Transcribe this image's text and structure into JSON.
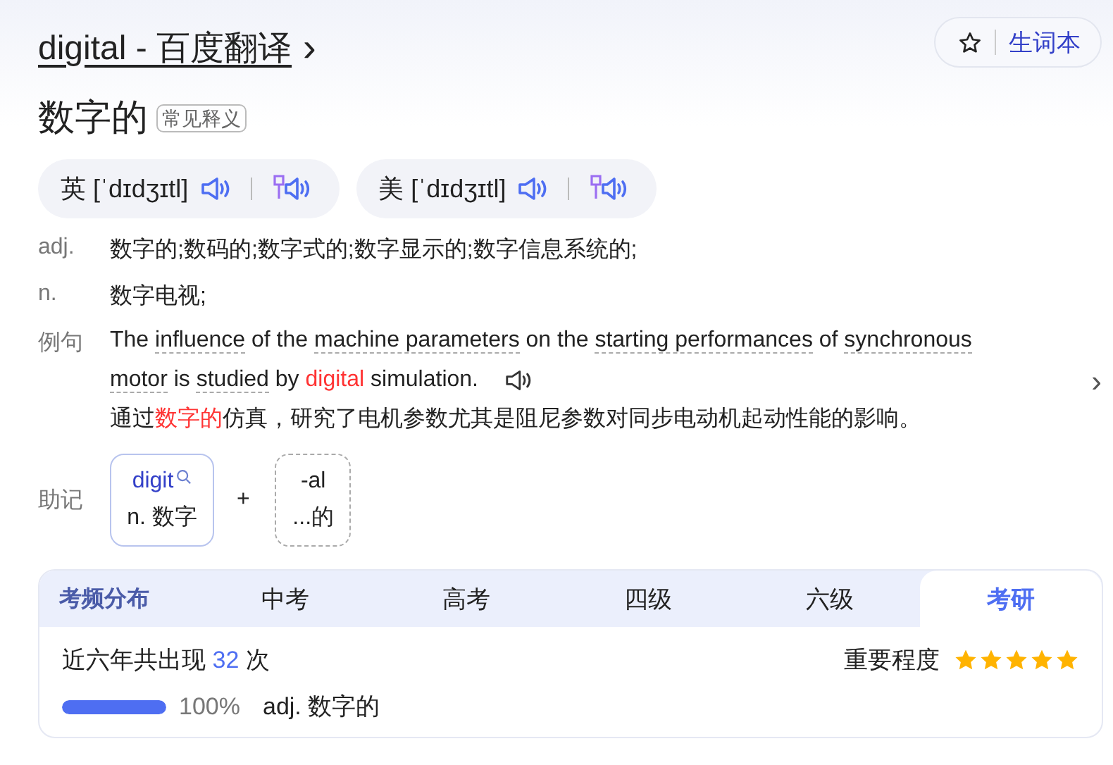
{
  "header": {
    "title": "digital - 百度翻译",
    "chevron": "›",
    "wordbook": "生词本"
  },
  "headword": {
    "text": "数字的",
    "tag": "常见释义"
  },
  "pronunciations": [
    {
      "region": "英",
      "phonetic": "[ˈdɪdʒɪtl]"
    },
    {
      "region": "美",
      "phonetic": "[ˈdɪdʒɪtl]"
    }
  ],
  "definitions": [
    {
      "pos": "adj.",
      "meaning": "数字的;数码的;数字式的;数字显示的;数字信息系统的;"
    },
    {
      "pos": "n.",
      "meaning": "数字电视;"
    }
  ],
  "example": {
    "label": "例句",
    "sentence": [
      {
        "kind": "plain",
        "text": "The "
      },
      {
        "kind": "term",
        "text": "influence"
      },
      {
        "kind": "plain",
        "text": " of the "
      },
      {
        "kind": "term",
        "text": "machine parameters"
      },
      {
        "kind": "plain",
        "text": " on the "
      },
      {
        "kind": "term",
        "text": "starting performances"
      },
      {
        "kind": "plain",
        "text": " of "
      },
      {
        "kind": "term",
        "text": "synchronous motor"
      },
      {
        "kind": "plain",
        "text": " is "
      },
      {
        "kind": "term",
        "text": "studied"
      },
      {
        "kind": "plain",
        "text": " by "
      },
      {
        "kind": "highlight",
        "text": "digital"
      },
      {
        "kind": "plain",
        "text": " simulation."
      }
    ],
    "translation": [
      {
        "kind": "plain",
        "text": "通过"
      },
      {
        "kind": "highlight",
        "text": "数字的"
      },
      {
        "kind": "plain",
        "text": "仿真，研究了电机参数尤其是阻尼参数对同步电动机起动性能的影响。"
      }
    ],
    "next": "›"
  },
  "mnemonic": {
    "label": "助记",
    "parts": [
      {
        "kind": "root",
        "word": "digit",
        "meaning": "n. 数字"
      },
      {
        "kind": "suffix",
        "word": "-al",
        "meaning": "...的"
      }
    ],
    "plus": "+"
  },
  "exam": {
    "title": "考频分布",
    "tabs": [
      {
        "label": "中考",
        "selected": false
      },
      {
        "label": "高考",
        "selected": false
      },
      {
        "label": "四级",
        "selected": false
      },
      {
        "label": "六级",
        "selected": false
      },
      {
        "label": "考研",
        "selected": true
      }
    ],
    "occurrence_prefix": "近六年共出现",
    "count": "32",
    "occurrence_suffix": "次",
    "importance_label": "重要程度",
    "stars": 5,
    "senses": [
      {
        "level": 1.0,
        "percent": "100%",
        "meaning": "adj. 数字的"
      }
    ]
  }
}
